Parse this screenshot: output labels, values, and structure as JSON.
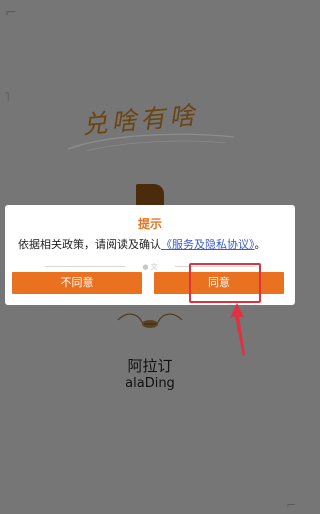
{
  "background": {
    "corner_glyph": "⌐",
    "corner_glyph_2": "˥",
    "corner_glyph_3": "⌐",
    "slogan": "兑啥有啥",
    "app_name_cn": "阿拉订",
    "app_name_en": "alaDing"
  },
  "dialog": {
    "title": "提示",
    "message_prefix": "依据相关政策，请阅读及确认",
    "message_link": "《服务及隐私协议》",
    "message_suffix": "。",
    "divider_label": "● 文",
    "disagree_label": "不同意",
    "agree_label": "同意"
  },
  "colors": {
    "accent": "#ea7120",
    "title": "#e8731e",
    "link": "#3a5bcc",
    "annotation": "#e2303f",
    "overlay": "#767676"
  }
}
